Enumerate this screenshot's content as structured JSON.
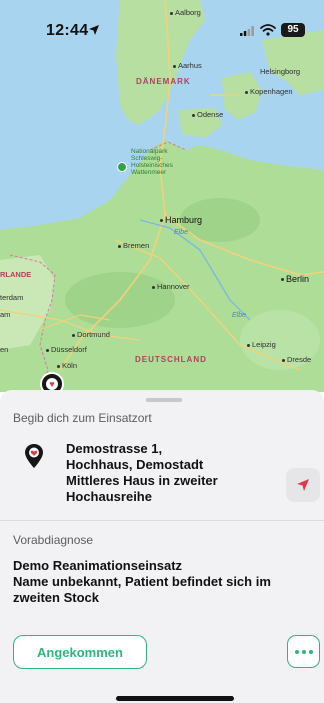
{
  "status_bar": {
    "time": "12:44",
    "battery": "95"
  },
  "map": {
    "labels": {
      "aalborg": "Aalborg",
      "aarhus": "Aarhus",
      "danemark": "DÄNEMARK",
      "helsingborg": "Helsingborg",
      "kopenhagen": "Kopenhagen",
      "odense": "Odense",
      "nationalpark": "Nationalpark Schleswig-Holsteinisches Wattenmeer",
      "hamburg": "Hamburg",
      "elbe_north": "Elbe",
      "bremen": "Bremen",
      "nederlande": "RLANDE",
      "amsterdam": "terdam",
      "am": "am",
      "hannover": "Hannover",
      "berlin": "Berlin",
      "elbe_south": "Elbe",
      "dortmund": "Dortmund",
      "en": "en",
      "dusseldorf": "Düsseldorf",
      "koln": "Köln",
      "leipzig": "Leipzig",
      "deutschland": "DEUTSCHLAND",
      "dresden": "Dresde"
    }
  },
  "sheet": {
    "destination_label": "Begib dich zum Einsatzort",
    "address_lines": [
      "Demostrasse 1,",
      "Hochhaus, Demostadt",
      "Mittleres Haus in zweiter",
      "Hochausreihe"
    ],
    "diagnosis_label": "Vorabdiagnose",
    "diagnosis_lines": [
      "Demo Reanimationseinsatz",
      "Name unbekannt, Patient befindet sich im",
      "zweiten Stock"
    ],
    "arrived_button": "Angekommen"
  },
  "colors": {
    "accent": "#2eb67d",
    "nav_arrow": "#e0394a",
    "pin": "#161616"
  },
  "icons": {
    "location_arrow": "location-arrow-icon",
    "signal": "cellular-signal-icon",
    "wifi": "wifi-icon",
    "destination_pin": "map-pin-heart-icon",
    "navigate": "navigation-arrow-icon",
    "more": "more-dots-icon"
  }
}
